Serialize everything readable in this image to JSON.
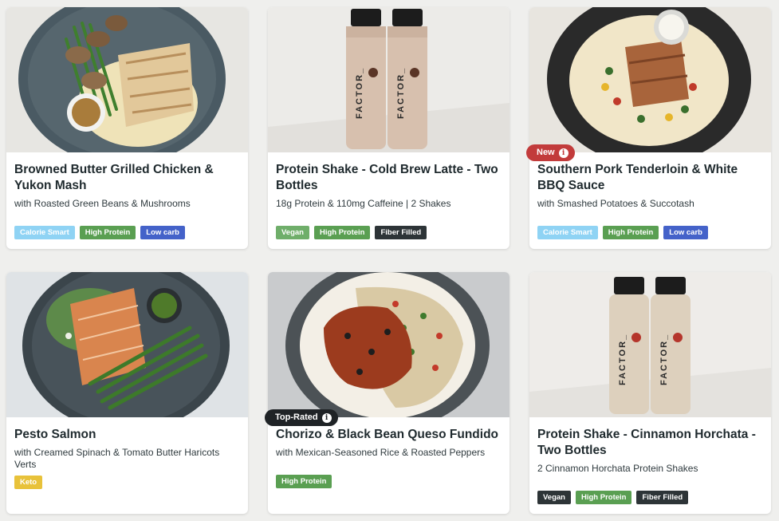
{
  "colors": {
    "calorie_smart": "#8fd3f4",
    "high_protein": "#5a9f52",
    "low_carb": "#4462c9",
    "vegan": "#6fae6a",
    "fiber_filled": "#2d3437",
    "keto": "#e8c23a",
    "badge_new": "#c23b3b",
    "badge_top_rated": "#1f2326"
  },
  "cards": [
    {
      "title": "Browned Butter Grilled Chicken & Yukon Mash",
      "subtitle": "with Roasted Green Beans & Mushrooms",
      "image": "chicken-plate-image",
      "tags": [
        "Calorie Smart",
        "High Protein",
        "Low carb"
      ]
    },
    {
      "title": "Protein Shake - Cold Brew Latte - Two Bottles",
      "subtitle": "18g Protein & 110mg Caffeine | 2 Shakes",
      "image": "cold-brew-bottles-image",
      "tags": [
        "Vegan",
        "High Protein",
        "Fiber Filled"
      ]
    },
    {
      "title": "Southern Pork Tenderloin & White BBQ Sauce",
      "subtitle": "with Smashed Potatoes & Succotash",
      "image": "pork-plate-image",
      "badge": "New",
      "tags": [
        "Calorie Smart",
        "High Protein",
        "Low carb"
      ]
    },
    {
      "title": "Pesto Salmon",
      "subtitle": "with Creamed Spinach & Tomato Butter Haricots Verts",
      "image": "salmon-plate-image",
      "tags": [
        "Keto"
      ]
    },
    {
      "title": "Chorizo & Black Bean Queso Fundido",
      "subtitle": "with Mexican-Seasoned Rice & Roasted Peppers",
      "image": "chorizo-plate-image",
      "badge": "Top-Rated",
      "tags": [
        "High Protein"
      ]
    },
    {
      "title": "Protein Shake - Cinnamon Horchata - Two Bottles",
      "subtitle": "2 Cinnamon Horchata Protein Shakes",
      "image": "horchata-bottles-image",
      "tags": [
        "Vegan",
        "High Protein",
        "Fiber Filled"
      ]
    }
  ],
  "bottle_text": {
    "brand": "FACTOR_",
    "cold_brew_flavor": "Cold Brew Latte",
    "horchata_flavor": "Cinnamon Horchata",
    "product": "PROTEIN SHAKE"
  }
}
